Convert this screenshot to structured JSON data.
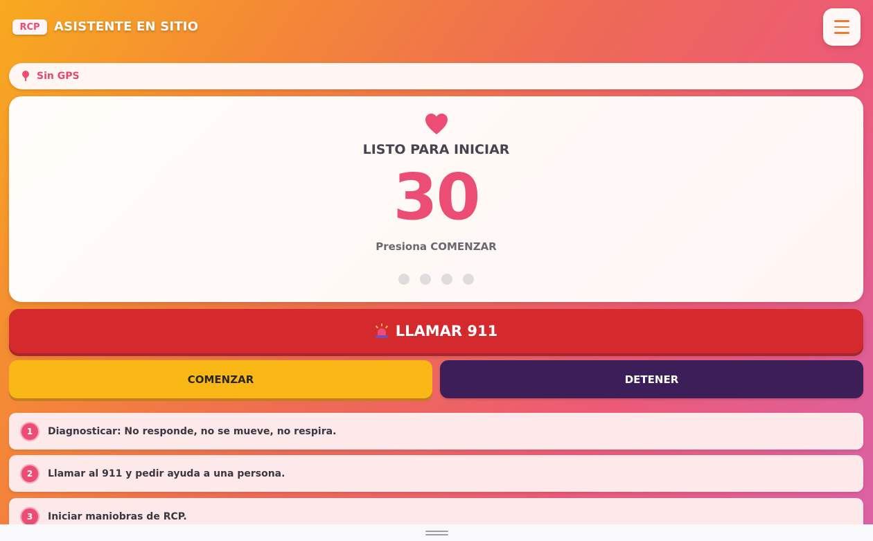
{
  "header": {
    "logo_text": "RCP",
    "title": "ASISTENTE EN SITIO",
    "menu_icon": "hamburger-menu-icon"
  },
  "location": {
    "icon": "map-pin-icon",
    "status_text": "Sin GPS"
  },
  "panel": {
    "icon": "heart-icon",
    "status_title": "LISTO PARA INICIAR",
    "counter": "30",
    "hint": "Presiona COMENZAR",
    "progress_dots_total": 4,
    "progress_dots_active": 0
  },
  "actions": {
    "call_label": "LLAMAR 911",
    "call_icon": "siren-icon",
    "start_label": "COMENZAR",
    "stop_label": "DETENER"
  },
  "steps": [
    {
      "number": "1",
      "text": "Diagnosticar: No responde, no se mueve, no respira."
    },
    {
      "number": "2",
      "text": "Llamar al 911 y pedir ayuda a una persona."
    },
    {
      "number": "3",
      "text": "Iniciar maniobras de RCP."
    }
  ],
  "colors": {
    "accent": "#ec4d74",
    "call_red": "#d42a2e",
    "start_yellow": "#fab817",
    "stop_purple": "#3c1f58"
  }
}
